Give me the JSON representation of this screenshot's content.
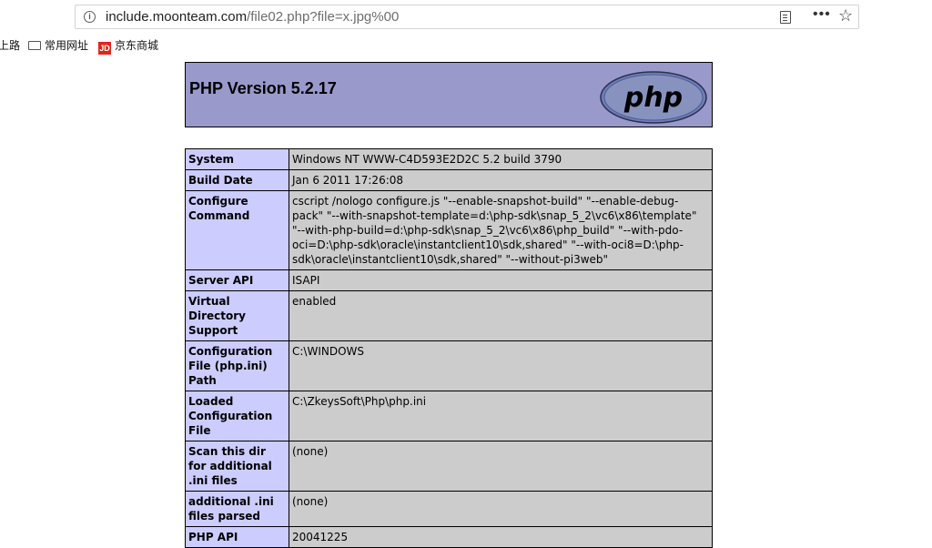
{
  "browser": {
    "url_host": "include.moonteam.com",
    "url_path": "/file02.php?file=x.jpg%00",
    "icons": [
      "info-icon",
      "reader-view-icon",
      "more-icon",
      "star-icon"
    ]
  },
  "bookmarks": {
    "items": [
      {
        "label": "上路",
        "icon": "none"
      },
      {
        "label": "常用网址",
        "icon": "folder-icon"
      },
      {
        "label": "京东商城",
        "icon": "jd-icon",
        "icon_text": "JD"
      }
    ]
  },
  "phpinfo": {
    "title": "PHP Version 5.2.17",
    "logo_text": "php",
    "colors": {
      "header": "#9999cc",
      "key": "#ccccff",
      "value": "#cccccc"
    },
    "rows": [
      {
        "key": "System",
        "value": "Windows NT WWW-C4D593E2D2C 5.2 build 3790"
      },
      {
        "key": "Build Date",
        "value": "Jan 6 2011 17:26:08"
      },
      {
        "key": "Configure Command",
        "value": "cscript /nologo configure.js \"--enable-snapshot-build\" \"--enable-debug-pack\" \"--with-snapshot-template=d:\\php-sdk\\snap_5_2\\vc6\\x86\\template\" \"--with-php-build=d:\\php-sdk\\snap_5_2\\vc6\\x86\\php_build\" \"--with-pdo-oci=D:\\php-sdk\\oracle\\instantclient10\\sdk,shared\" \"--with-oci8=D:\\php-sdk\\oracle\\instantclient10\\sdk,shared\" \"--without-pi3web\""
      },
      {
        "key": "Server API",
        "value": "ISAPI"
      },
      {
        "key": "Virtual Directory Support",
        "value": "enabled"
      },
      {
        "key": "Configuration File (php.ini) Path",
        "value": "C:\\WINDOWS"
      },
      {
        "key": "Loaded Configuration File",
        "value": "C:\\ZkeysSoft\\Php\\php.ini"
      },
      {
        "key": "Scan this dir for additional .ini files",
        "value": "(none)"
      },
      {
        "key": "additional .ini files parsed",
        "value": "(none)"
      },
      {
        "key": "PHP API",
        "value": "20041225"
      }
    ]
  }
}
